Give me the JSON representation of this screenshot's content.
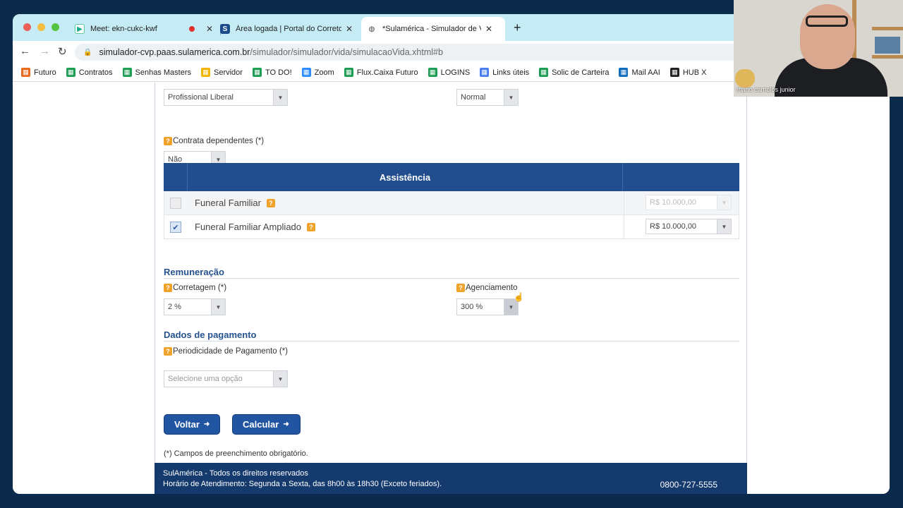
{
  "browser": {
    "tabs": [
      {
        "label": "Meet: ekn-cukc-kwf",
        "icon": "google-meet-icon"
      },
      {
        "label": "Área logada | Portal do Corretor",
        "icon": "sulamerica-s-icon"
      },
      {
        "label": "*Sulamérica - Simulador de Vida",
        "icon": "globe-icon"
      }
    ],
    "url_host": "simulador-cvp.paas.sulamerica.com.br",
    "url_path": "/simulador/simulador/vida/simulacaoVida.xhtml#b",
    "bookmarks": [
      {
        "label": "Futuro",
        "icon": "feather-icon",
        "color": "#e86a1e"
      },
      {
        "label": "Contratos",
        "icon": "sheets-icon",
        "color": "#1e9e55"
      },
      {
        "label": "Senhas Masters",
        "icon": "sheets-icon",
        "color": "#1e9e55"
      },
      {
        "label": "Servidor",
        "icon": "drive-icon",
        "color": "#f2b400"
      },
      {
        "label": "TO DO!",
        "icon": "sheets-icon",
        "color": "#1e9e55"
      },
      {
        "label": "Zoom",
        "icon": "zoom-icon",
        "color": "#2d8cff"
      },
      {
        "label": "Flux.Caixa Futuro",
        "icon": "sheets-icon",
        "color": "#1e9e55"
      },
      {
        "label": "LOGINS",
        "icon": "sheets-icon",
        "color": "#1e9e55"
      },
      {
        "label": "Links úteis",
        "icon": "docs-icon",
        "color": "#4a7ef0"
      },
      {
        "label": "Solic de Carteira",
        "icon": "sheets-icon",
        "color": "#1e9e55"
      },
      {
        "label": "Mail AAI",
        "icon": "outlook-icon",
        "color": "#0f6cbd"
      },
      {
        "label": "HUB X",
        "icon": "hub-icon",
        "color": "#222222"
      }
    ]
  },
  "form": {
    "categoria": {
      "value": "Profissional Liberal"
    },
    "franquia": {
      "value": "Normal"
    },
    "dependentes": {
      "label": "Contrata dependentes (*)",
      "value": "Não"
    },
    "assistencia": {
      "header": "Assistência",
      "rows": [
        {
          "name": "Funeral Familiar",
          "checked": false,
          "value": "R$ 10.000,00",
          "disabled": true
        },
        {
          "name": "Funeral Familiar Ampliado",
          "checked": true,
          "value": "R$ 10.000,00",
          "disabled": false
        }
      ]
    },
    "remuneracao": {
      "title": "Remuneração",
      "corretagem": {
        "label": "Corretagem (*)",
        "value": "2 %"
      },
      "agenciamento": {
        "label": "Agenciamento",
        "value": "300 %"
      }
    },
    "pagamento": {
      "title": "Dados de pagamento",
      "periodicidade": {
        "label": "Periodicidade de Pagamento (*)",
        "value": "Selecione uma opção"
      }
    },
    "buttons": {
      "voltar": "Voltar",
      "calcular": "Calcular"
    },
    "note": "(*) Campos de preenchimento obrigatório."
  },
  "footer": {
    "line1": "SulAmérica - Todos os direitos reservados",
    "line2": "Horário de Atendimento: Segunda a Sexta, das 8h00 às 18h30 (Exceto feriados).",
    "phone": "0800-727-5555"
  },
  "video": {
    "name": "mario carnelos junior"
  },
  "colors": {
    "brand_blue": "#214d8f",
    "footer_blue": "#153a6e",
    "help_orange": "#f0a32a",
    "tabbar": "#c5ecf5"
  }
}
